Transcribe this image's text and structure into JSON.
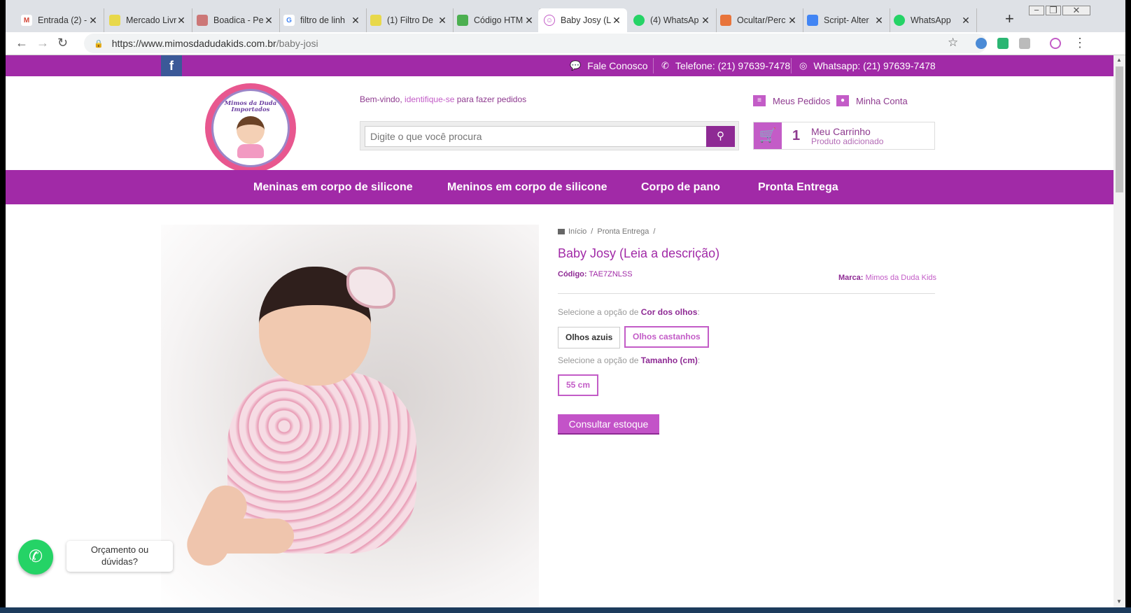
{
  "tabs": [
    {
      "label": "Entrada (2) -",
      "color": "#d44638",
      "glyph": "M"
    },
    {
      "label": "Mercado Livre",
      "color": "#e8d84a",
      "glyph": "●"
    },
    {
      "label": "Boadica - Pe",
      "color": "#c77",
      "glyph": "≡"
    },
    {
      "label": "filtro de linh",
      "color": "#4285f4",
      "glyph": "G"
    },
    {
      "label": "(1) Filtro De",
      "color": "#e8d84a",
      "glyph": "●"
    },
    {
      "label": "Código HTM",
      "color": "#4caf50",
      "glyph": "◆"
    },
    {
      "label": "Baby Josy (L",
      "color": "#c35cc7",
      "glyph": "☺"
    },
    {
      "label": "(4) WhatsAp",
      "color": "#25d366",
      "glyph": "✆"
    },
    {
      "label": "Ocultar/Perc",
      "color": "#e8743b",
      "glyph": "■"
    },
    {
      "label": "Script- Alter",
      "color": "#4285f4",
      "glyph": "≡"
    },
    {
      "label": "WhatsApp",
      "color": "#25d366",
      "glyph": "✆"
    }
  ],
  "newtab_glyph": "+",
  "window_controls": {
    "minimize": "−",
    "restore": "❐",
    "close": "✕"
  },
  "address": {
    "domain": "https://www.mimosdadudakids.com.br",
    "path": "/baby-josi"
  },
  "topbar": {
    "facebook": "f",
    "fale": "Fale Conosco",
    "telefone": "Telefone: (21) 97639-7478",
    "whatsapp": "Whatsapp: (21) 97639-7478"
  },
  "logo": {
    "line1": "Mimos da Duda",
    "line2": "Importados"
  },
  "welcome": {
    "pre": "Bem-vindo, ",
    "link": "identifique-se",
    "post": " para fazer pedidos"
  },
  "search": {
    "placeholder": "Digite o que você procura"
  },
  "account": {
    "orders": "Meus Pedidos",
    "account": "Minha Conta"
  },
  "cart": {
    "count": "1",
    "title": "Meu Carrinho",
    "subtitle": "Produto adicionado"
  },
  "nav": [
    "Meninas em corpo de silicone",
    "Meninos em corpo de silicone",
    "Corpo de pano",
    "Pronta Entrega"
  ],
  "breadcrumb": {
    "home": "Início",
    "category": "Pronta Entrega"
  },
  "product": {
    "title": "Baby Josy (Leia a descrição)",
    "code_label": "Código:",
    "code": "TAE7ZNLSS",
    "brand_label": "Marca:",
    "brand": "Mimos da Duda Kids"
  },
  "options": {
    "eyes_pre": "Selecione a opção de ",
    "eyes_name": "Cor dos olhos",
    "eyes_post": ":",
    "eyes_values": [
      "Olhos azuis",
      "Olhos castanhos"
    ],
    "size_pre": "Selecione a opção de ",
    "size_name": "Tamanho (cm)",
    "size_post": ":",
    "size_values": [
      "55 cm"
    ]
  },
  "stock_button": "Consultar estoque",
  "whatsapp_widget": {
    "line1": "Orçamento ou",
    "line2": "dúvidas?"
  }
}
